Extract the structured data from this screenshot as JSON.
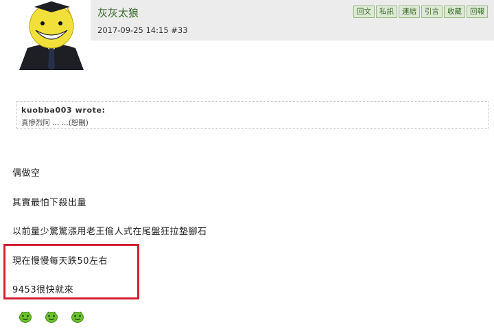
{
  "post": {
    "username": "灰灰太狼",
    "timestamp": "2017-09-25 14:15  #33"
  },
  "toolbar": {
    "buttons": [
      "回文",
      "私訊",
      "連結",
      "引言",
      "收藏",
      "回報"
    ]
  },
  "quote": {
    "author": "kuobba003 wrote:",
    "text": "真慘烈阿 ... ...(恕刪)"
  },
  "body": {
    "lines": [
      "偶做空",
      "其實最怕下殺出量",
      "以前量少驚驚漲用老王偷人式在尾盤狂拉墊腳石",
      "現在慢慢每天跌50左右",
      "9453很快就來"
    ]
  },
  "icons": {
    "avatar": "koro-sensei-avatar",
    "emoticon": "green-smiley-icon"
  },
  "colors": {
    "username": "#3a6a2a",
    "button_bg": "#dde9d4",
    "highlight_border": "#d0202e",
    "header_bg": "#ececec"
  }
}
